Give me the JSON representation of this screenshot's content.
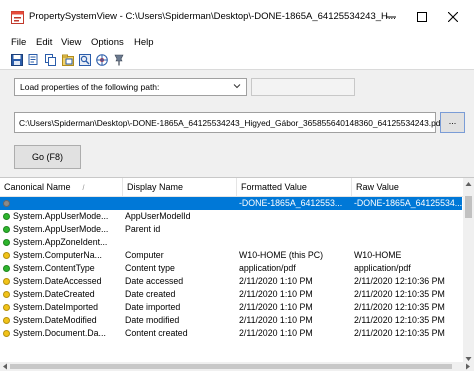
{
  "window": {
    "title": "PropertySystemView  -  C:\\Users\\Spiderman\\Desktop\\-DONE-1865A_64125534243_H..."
  },
  "menu": [
    "File",
    "Edit",
    "View",
    "Options",
    "Help"
  ],
  "toolbar_icons": [
    "save-icon",
    "copy-icon",
    "copy-all-icon",
    "properties-icon",
    "find-icon",
    "web-icon",
    "pin-icon"
  ],
  "panel": {
    "mode_select": "Load properties of the following path:",
    "path": "C:\\Users\\Spiderman\\Desktop\\-DONE-1865A_64125534243_Higyed_Gábor_365855640148360_64125534243.pdf",
    "browse_label": "...",
    "go_label": "Go (F8)"
  },
  "list": {
    "columns": [
      "Canonical Name",
      "Display Name",
      "Formatted Value",
      "Raw Value"
    ],
    "sort_indicator": "/",
    "rows": [
      {
        "name": "",
        "display": "",
        "formatted": "-DONE-1865A_6412553...",
        "raw": "-DONE-1865A_64125534...",
        "status": "gray",
        "selected": true
      },
      {
        "name": "System.AppUserMode...",
        "display": "AppUserModelId",
        "formatted": "",
        "raw": "",
        "status": "green",
        "selected": false
      },
      {
        "name": "System.AppUserMode...",
        "display": "Parent id",
        "formatted": "",
        "raw": "",
        "status": "green",
        "selected": false
      },
      {
        "name": "System.AppZoneIdent...",
        "display": "",
        "formatted": "",
        "raw": "",
        "status": "green",
        "selected": false
      },
      {
        "name": "System.ComputerNa...",
        "display": "Computer",
        "formatted": "W10-HOME (this PC)",
        "raw": "W10-HOME",
        "status": "yellow",
        "selected": false
      },
      {
        "name": "System.ContentType",
        "display": "Content type",
        "formatted": "application/pdf",
        "raw": "application/pdf",
        "status": "green",
        "selected": false
      },
      {
        "name": "System.DateAccessed",
        "display": "Date accessed",
        "formatted": "2/11/2020 1:10 PM",
        "raw": "2/11/2020 12:10:36 PM",
        "status": "yellow",
        "selected": false
      },
      {
        "name": "System.DateCreated",
        "display": "Date created",
        "formatted": "2/11/2020 1:10 PM",
        "raw": "2/11/2020 12:10:35 PM",
        "status": "yellow",
        "selected": false
      },
      {
        "name": "System.DateImported",
        "display": "Date imported",
        "formatted": "2/11/2020 1:10 PM",
        "raw": "2/11/2020 12:10:35 PM",
        "status": "yellow",
        "selected": false
      },
      {
        "name": "System.DateModified",
        "display": "Date modified",
        "formatted": "2/11/2020 1:10 PM",
        "raw": "2/11/2020 12:10:35 PM",
        "status": "yellow",
        "selected": false
      },
      {
        "name": "System.Document.Da...",
        "display": "Content created",
        "formatted": "2/11/2020 1:10 PM",
        "raw": "2/11/2020 12:10:35 PM",
        "status": "yellow",
        "selected": false
      }
    ]
  },
  "colors": {
    "selection": "#0078d7",
    "status_green": "#2db52d",
    "status_yellow": "#f2c318",
    "status_gray": "#8a8a8a"
  }
}
